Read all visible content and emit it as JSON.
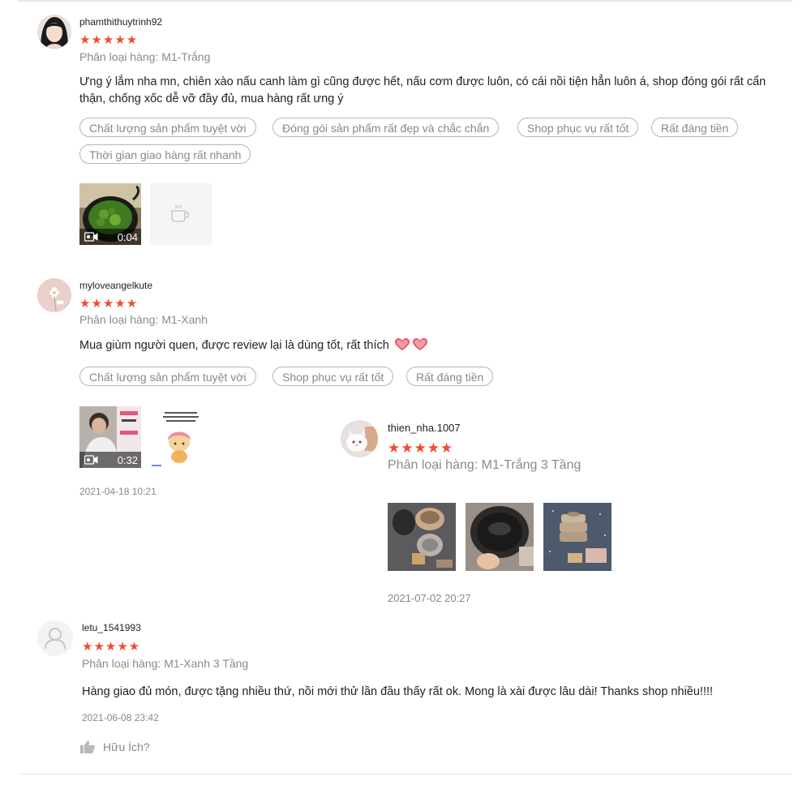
{
  "reviews": [
    {
      "username": "phamthithuytrinh92",
      "stars": "★★★★★",
      "variant": "Phân loại hàng: M1-Trắng",
      "content": "Ưng ý lắm nha mn, chiên xào nấu canh làm gì cũng được hết, nấu cơm được luôn, có cái nồi tiện hẳn luôn á, shop đóng gói rất cẩn thận, chống xốc dễ vỡ đầy đủ, mua hàng rất ưng ý",
      "tags": [
        "Chất lượng sản phẩm tuyệt vời",
        "Đóng gói sản phẩm rất đẹp và chắc chắn",
        "Shop phục vụ rất tốt",
        "Rất đáng tiền",
        "Thời gian giao hàng rất nhanh"
      ],
      "video_duration": "0:04"
    },
    {
      "username": "myloveangelkute",
      "stars": "★★★★★",
      "variant": "Phân loại hàng: M1-Xanh",
      "content": "Mua giùm người quen, được review lại là dùng tốt, rất thích",
      "tags": [
        "Chất lượng sản phẩm tuyệt vời",
        "Shop phục vụ rất tốt",
        "Rất đáng tiền"
      ],
      "video_duration": "0:32",
      "date": "2021-04-18 10:21"
    },
    {
      "username": "thien_nha.1007",
      "stars": "★★★★★",
      "variant": "Phân loại hàng: M1-Trắng 3 Tầng",
      "date": "2021-07-02 20:27"
    },
    {
      "username": "letu_1541993",
      "stars": "★★★★★",
      "variant": "Phân loại hàng: M1-Xanh 3 Tầng",
      "content": "Hàng giao đủ món, được tặng nhiều thứ, nồi mới thử lần đầu thấy rất ok. Mong là xài được lâu dài! Thanks shop nhiều!!!!",
      "date": "2021-06-08 23:42",
      "helpful": "Hữu Ích?"
    }
  ],
  "colors": {
    "star": "#ee4d2d",
    "muted": "#888888",
    "tag_border": "#b5b5b5"
  },
  "icons": [
    "video-camera-icon",
    "coffee-cup-placeholder-icon",
    "heart-emoji-icon",
    "user-avatar-icon",
    "thumbs-up-icon"
  ]
}
